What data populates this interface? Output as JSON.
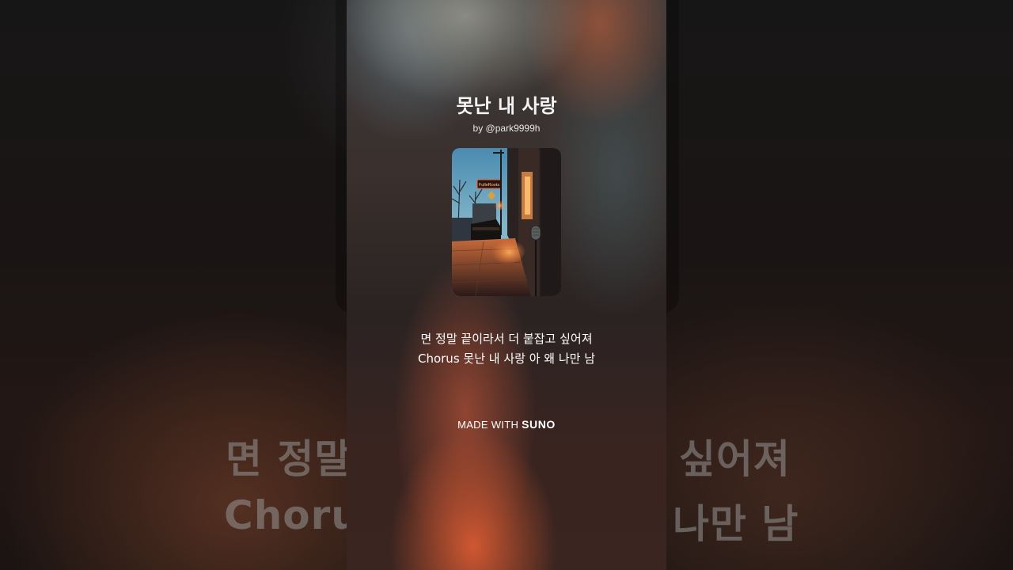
{
  "song": {
    "title": "못난 내 사랑",
    "byline": "by @park9999h"
  },
  "lyrics": {
    "line1": "면 정말 끝이라서  더 붙잡고 싶어져",
    "line2": "Chorus  못난 내 사랑 아 왜 나만 남"
  },
  "background": {
    "line1_left": "면 정말",
    "line1_right": "싶어져",
    "line2_left": "Chorus",
    "line2_right": "나만 남"
  },
  "footer": {
    "made_with": "MADE WITH",
    "brand": "SUNO"
  },
  "cover_art": {
    "sign_text": "FulleRoots"
  },
  "colors": {
    "text": "#ffffff",
    "glow": "#d95a32"
  }
}
